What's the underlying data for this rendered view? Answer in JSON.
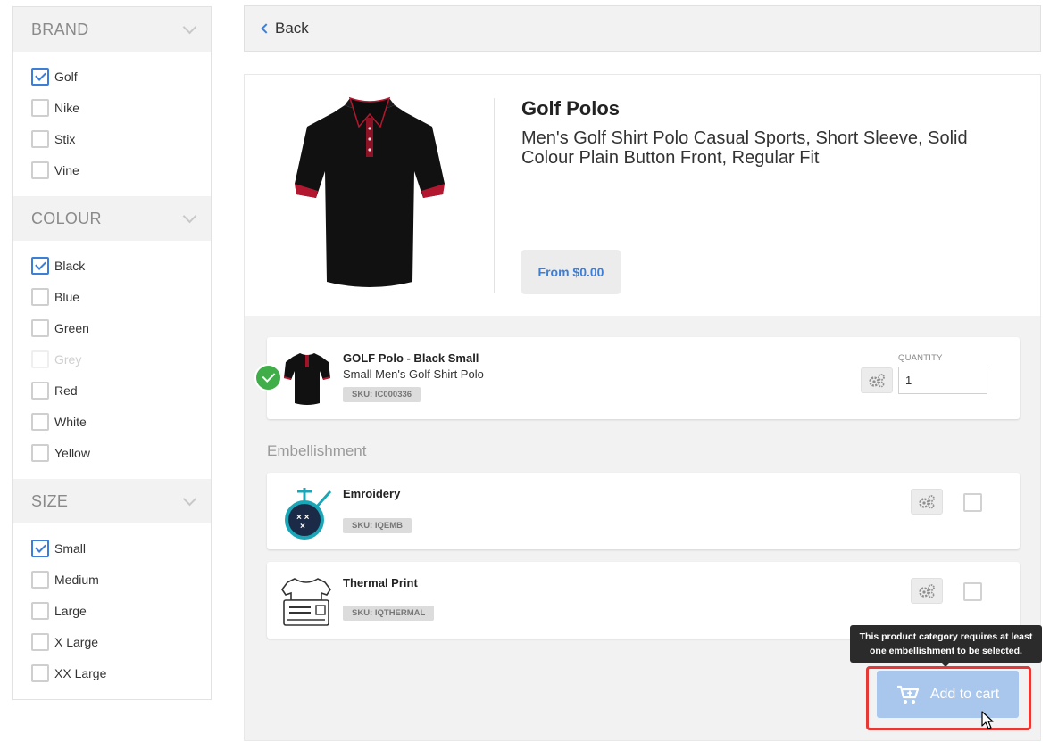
{
  "filters": {
    "brand": {
      "title": "BRAND",
      "items": [
        {
          "label": "Golf",
          "checked": true
        },
        {
          "label": "Nike",
          "checked": false
        },
        {
          "label": "Stix",
          "checked": false
        },
        {
          "label": "Vine",
          "checked": false
        }
      ]
    },
    "colour": {
      "title": "COLOUR",
      "items": [
        {
          "label": "Black",
          "checked": true
        },
        {
          "label": "Blue",
          "checked": false
        },
        {
          "label": "Green",
          "checked": false
        },
        {
          "label": "Grey",
          "checked": false,
          "disabled": true
        },
        {
          "label": "Red",
          "checked": false
        },
        {
          "label": "White",
          "checked": false
        },
        {
          "label": "Yellow",
          "checked": false
        }
      ]
    },
    "size": {
      "title": "SIZE",
      "items": [
        {
          "label": "Small",
          "checked": true
        },
        {
          "label": "Medium",
          "checked": false
        },
        {
          "label": "Large",
          "checked": false
        },
        {
          "label": "X Large",
          "checked": false
        },
        {
          "label": "XX Large",
          "checked": false
        }
      ]
    }
  },
  "nav": {
    "back_label": "Back"
  },
  "product": {
    "title": "Golf Polos",
    "description": "Men's Golf Shirt Polo Casual Sports, Short Sleeve, Solid Colour Plain Button Front, Regular Fit",
    "price_label": "From $0.00"
  },
  "variant": {
    "title": "GOLF Polo - Black Small",
    "subtitle": "Small Men's Golf Shirt Polo",
    "sku": "SKU: IC000336",
    "quantity_label": "QUANTITY",
    "quantity_value": "1",
    "selected": true
  },
  "embellishment": {
    "heading": "Embellishment",
    "items": [
      {
        "title": "Emroidery",
        "sku": "SKU: IQEMB",
        "checked": false
      },
      {
        "title": "Thermal Print",
        "sku": "SKU: IQTHERMAL",
        "checked": false
      }
    ]
  },
  "cart": {
    "tooltip_line1": "This product category requires at least",
    "tooltip_line2": "one embellishment to be selected.",
    "button_label": "Add to cart",
    "disabled": true
  },
  "colors": {
    "accent": "#3d7fd6",
    "success": "#3fae49",
    "highlight": "#e53935",
    "cart_disabled": "#a9c6ec"
  }
}
